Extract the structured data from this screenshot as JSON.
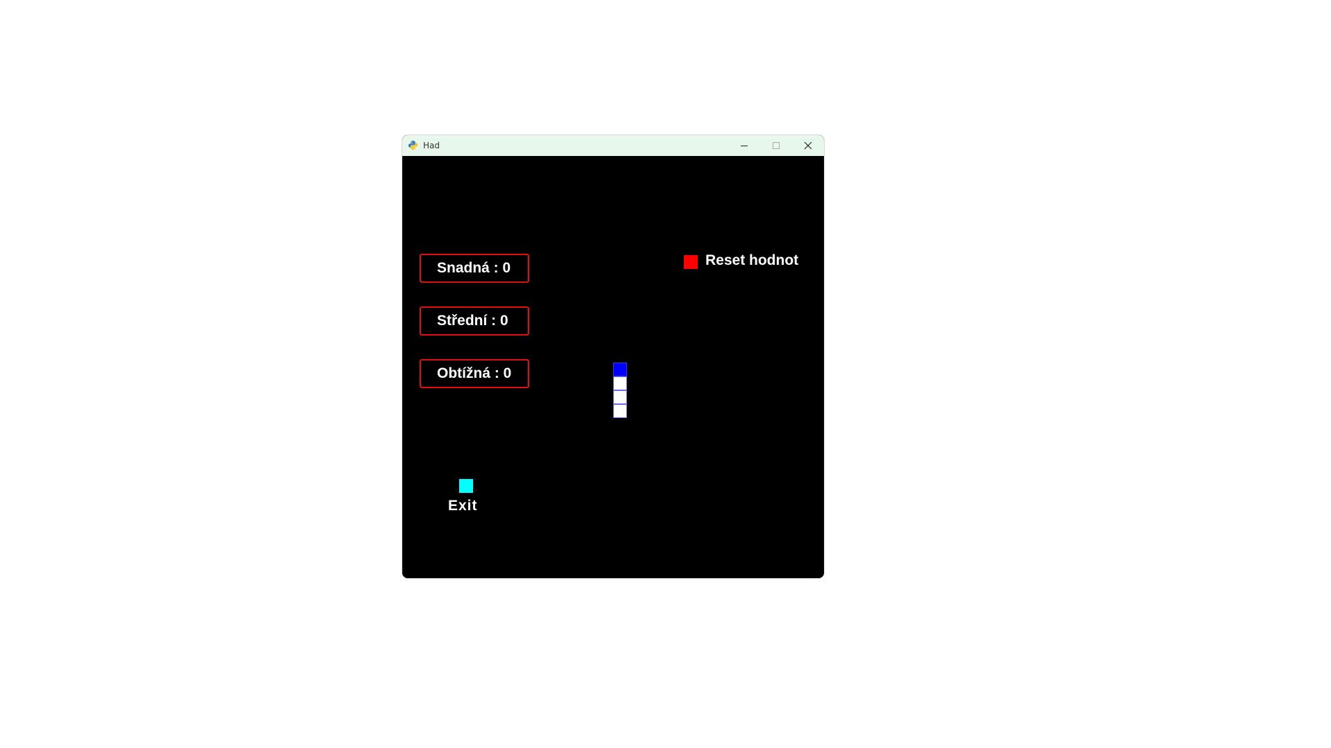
{
  "window": {
    "title": "Had",
    "icon": "python-icon",
    "controls": {
      "minimize": "minimize-icon",
      "maximize": "maximize-icon",
      "close": "close-icon"
    }
  },
  "scores": {
    "easy": "Snadná : 0",
    "medium": "Střední : 0",
    "hard": "Obtížná : 0"
  },
  "reset": {
    "label": "Reset hodnot",
    "color": "#ff0000"
  },
  "exit": {
    "label": "Exit",
    "color": "#00ffff"
  },
  "snake": {
    "segments": 4,
    "head_color": "#0000ff",
    "body_color": "#ffffff"
  },
  "colors": {
    "background": "#000000",
    "border": "#e01010",
    "titlebar": "#e8f7ec"
  }
}
